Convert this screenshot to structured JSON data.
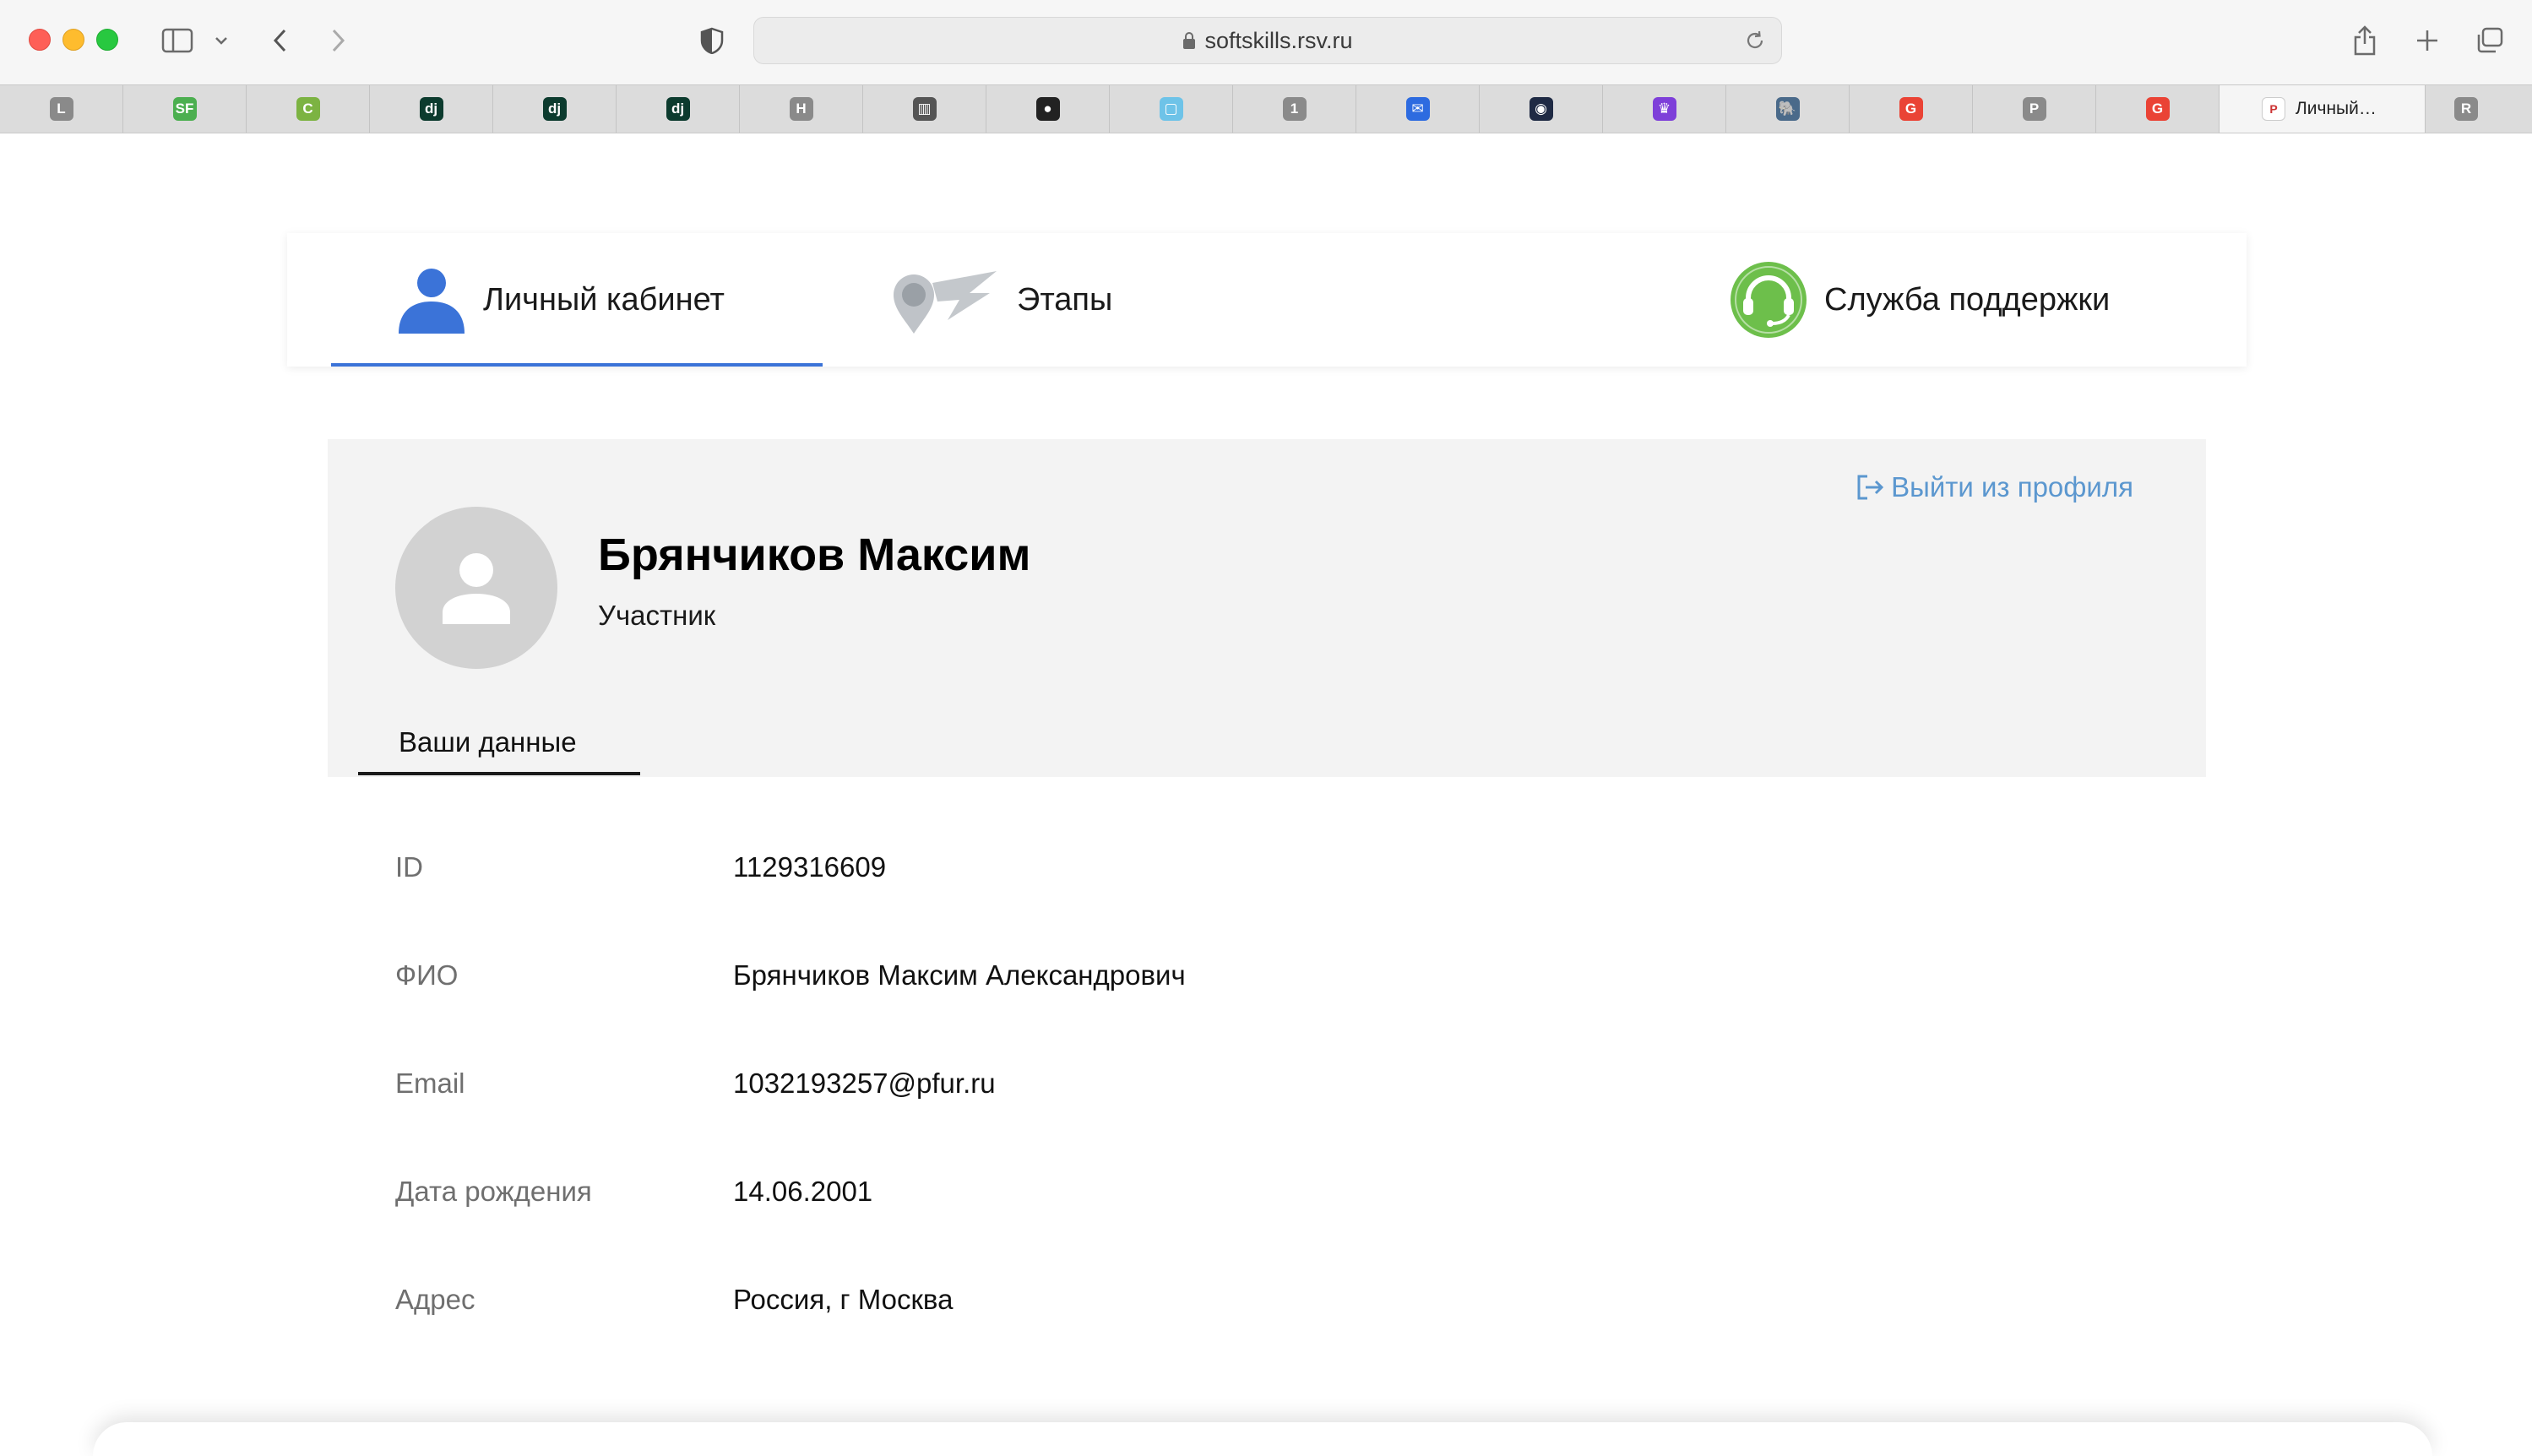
{
  "browser": {
    "url": "softskills.rsv.ru",
    "tabs": [
      {
        "fav": "L",
        "color": "#8a8a8a"
      },
      {
        "fav": "SF",
        "color": "#4caf50"
      },
      {
        "fav": "C",
        "color": "#7cb342"
      },
      {
        "fav": "dj",
        "color": "#0c3b2e"
      },
      {
        "fav": "dj",
        "color": "#0c3b2e"
      },
      {
        "fav": "dj",
        "color": "#0c3b2e"
      },
      {
        "fav": "H",
        "color": "#8a8a8a"
      },
      {
        "fav": "▥",
        "color": "#555555"
      },
      {
        "fav": "●",
        "color": "#222222"
      },
      {
        "fav": "▢",
        "color": "#6ec3e8"
      },
      {
        "fav": "1",
        "color": "#8a8a8a"
      },
      {
        "fav": "✉",
        "color": "#2d6be0"
      },
      {
        "fav": "◉",
        "color": "#1f2a44"
      },
      {
        "fav": "♛",
        "color": "#7e3fd9"
      },
      {
        "fav": "🐘",
        "color": "#4a6a8a"
      },
      {
        "fav": "G",
        "color": "#ea4335"
      },
      {
        "fav": "P",
        "color": "#8a8a8a"
      },
      {
        "fav": "G",
        "color": "#ea4335"
      }
    ],
    "active_tab": {
      "label": "Личный…",
      "fav": "Р"
    },
    "last_tab": {
      "fav": "R",
      "color": "#8a8a8a"
    }
  },
  "nav": {
    "cabinet": "Личный кабинет",
    "stages": "Этапы",
    "support": "Служба поддержки"
  },
  "profile": {
    "logout": "Выйти из профиля",
    "name": "Брянчиков Максим",
    "role": "Участник",
    "tab": "Ваши данные"
  },
  "info": {
    "rows": [
      {
        "label": "ID",
        "value": "1129316609"
      },
      {
        "label": "ФИО",
        "value": "Брянчиков Максим Александрович"
      },
      {
        "label": "Email",
        "value": "1032193257@pfur.ru"
      },
      {
        "label": "Дата рождения",
        "value": "14.06.2001"
      },
      {
        "label": "Адрес",
        "value": "Россия, г Москва"
      }
    ]
  },
  "colors": {
    "accent": "#3b73d8",
    "logout_link": "#5b97cf",
    "support_green": "#6dbf4b",
    "avatar_bg": "#d2d2d2"
  }
}
